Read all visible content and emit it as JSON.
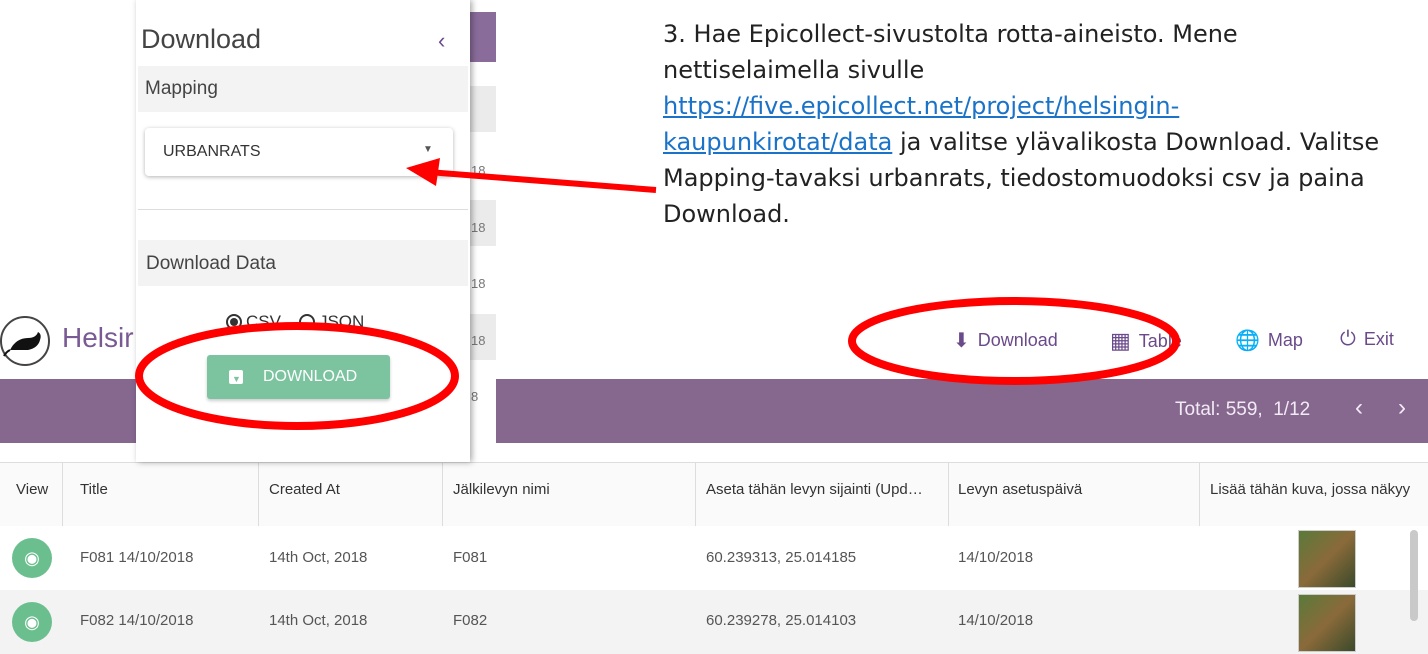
{
  "instruction": {
    "text_before": "3. Hae Epicollect-sivustolta rotta-aineisto. Mene nettiselaimella sivulle ",
    "link": "https://five.epicollect.net/project/helsingin-kaupunkirotat/data",
    "text_after": " ja valitse ylävalikosta Download. Valitse Mapping-tavaksi urbanrats, tiedostomuodoksi csv ja paina Download."
  },
  "download_panel": {
    "title": "Download",
    "collapse_icon": "chevron-left-icon",
    "mapping_label": "Mapping",
    "mapping_value": "URBANRATS",
    "download_data_label": "Download Data",
    "format_options": [
      {
        "label": "CSV",
        "selected": true
      },
      {
        "label": "JSON",
        "selected": false
      }
    ],
    "download_button": "DOWNLOAD"
  },
  "background_strip_numbers": [
    "18",
    "18",
    "18",
    "18",
    "8"
  ],
  "app": {
    "title": "Helsir",
    "nav": [
      {
        "label": "Download",
        "icon": "download-icon"
      },
      {
        "label": "Table",
        "icon": "table-icon"
      },
      {
        "label": "Map",
        "icon": "globe-icon"
      },
      {
        "label": "Exit",
        "icon": "power-icon"
      }
    ],
    "total_text": "Total: 559,",
    "page_text": "1/12",
    "prev_icon": "chevron-left-icon",
    "next_icon": "chevron-right-icon",
    "accent_color": "#86688f"
  },
  "table": {
    "headers": [
      "View",
      "Title",
      "Created At",
      "Jälkilevyn nimi",
      "Aseta tähän levyn sijainti (Upd…",
      "Levyn asetuspäivä",
      "Lisää tähän kuva, jossa näkyy"
    ],
    "rows": [
      {
        "title": "F081 14/10/2018",
        "created": "14th Oct, 2018",
        "name": "F081",
        "location": "60.239313, 25.014185",
        "date": "14/10/2018"
      },
      {
        "title": "F082 14/10/2018",
        "created": "14th Oct, 2018",
        "name": "F082",
        "location": "60.239278, 25.014103",
        "date": "14/10/2018"
      }
    ]
  }
}
